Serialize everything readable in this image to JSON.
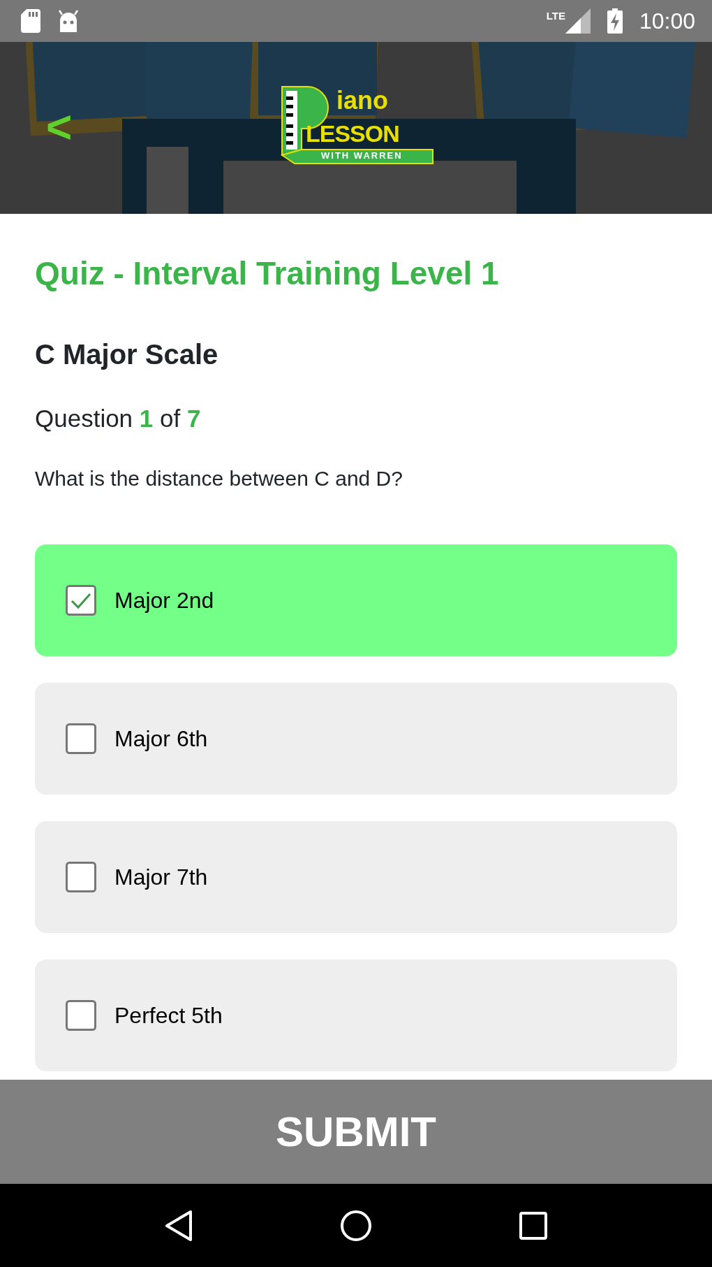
{
  "status_bar": {
    "network": "LTE",
    "time": "10:00"
  },
  "header": {
    "back": "<",
    "logo": {
      "word": "iano",
      "middle": "LESSON",
      "tagline": "WITH WARREN"
    }
  },
  "quiz": {
    "title": "Quiz - Interval Training Level 1",
    "section": "C Major Scale",
    "progress": [
      {
        "text": "Question",
        "highlighted": false
      },
      {
        "text": "1",
        "highlighted": true
      },
      {
        "text": "of",
        "highlighted": false
      },
      {
        "text": "7",
        "highlighted": true
      }
    ],
    "question": "What is the distance between C and D?"
  },
  "options": [
    {
      "label": "Major 2nd",
      "checked": true
    },
    {
      "label": "Major 6th",
      "checked": false
    },
    {
      "label": "Major 7th",
      "checked": false
    },
    {
      "label": "Perfect 5th",
      "checked": false
    }
  ],
  "submit": "SUBMIT"
}
